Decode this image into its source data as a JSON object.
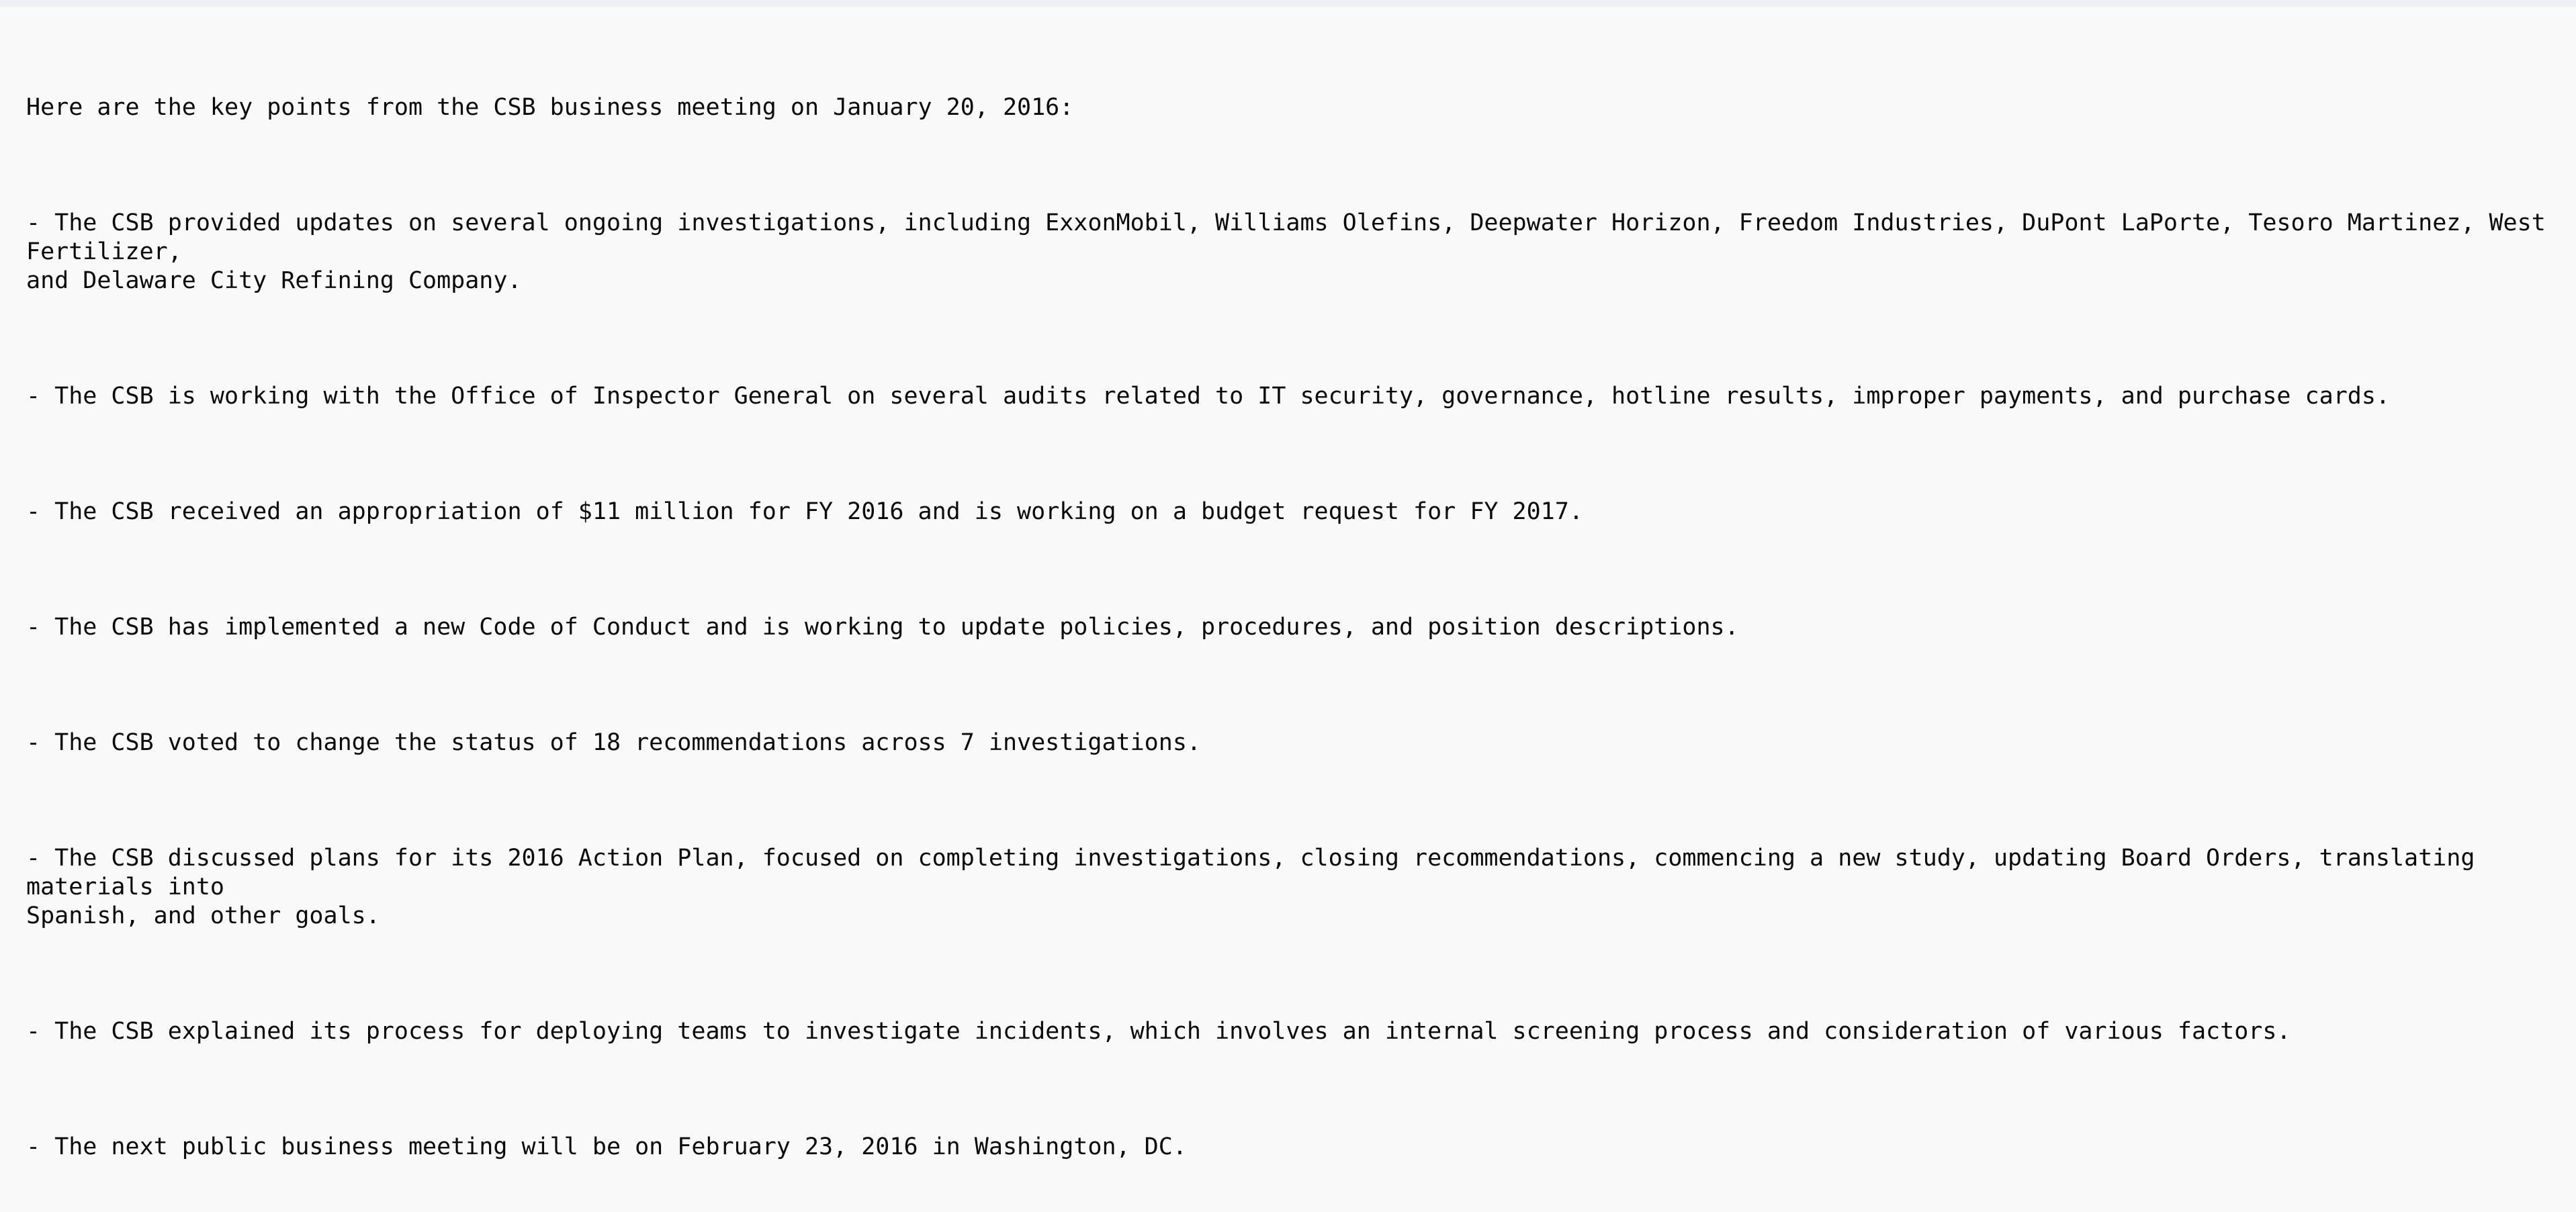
{
  "document": {
    "intro": "Here are the key points from the CSB business meeting on January 20, 2016:",
    "points": [
      "- The CSB provided updates on several ongoing investigations, including ExxonMobil, Williams Olefins, Deepwater Horizon, Freedom Industries, DuPont LaPorte, Tesoro Martinez, West Fertilizer,\nand Delaware City Refining Company.",
      "- The CSB is working with the Office of Inspector General on several audits related to IT security, governance, hotline results, improper payments, and purchase cards.",
      "- The CSB received an appropriation of $11 million for FY 2016 and is working on a budget request for FY 2017.",
      "- The CSB has implemented a new Code of Conduct and is working to update policies, procedures, and position descriptions.",
      "- The CSB voted to change the status of 18 recommendations across 7 investigations.",
      "- The CSB discussed plans for its 2016 Action Plan, focused on completing investigations, closing recommendations, commencing a new study, updating Board Orders, translating materials into\nSpanish, and other goals.",
      "- The CSB explained its process for deploying teams to investigate incidents, which involves an internal screening process and consideration of various factors.",
      "- The next public business meeting will be on February 23, 2016 in Washington, DC."
    ]
  }
}
